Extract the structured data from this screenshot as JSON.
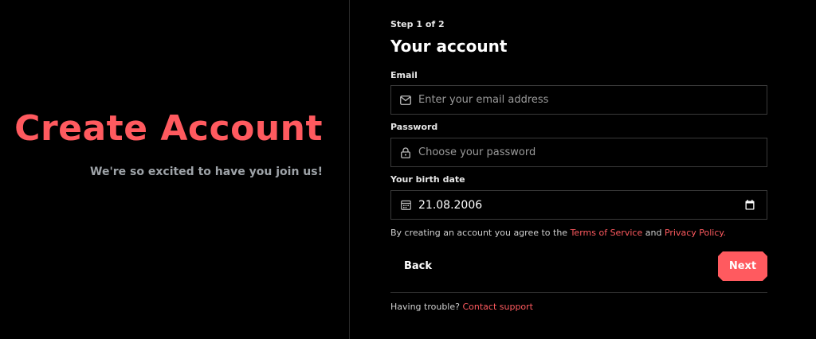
{
  "hero": {
    "title": "Create Account",
    "subtitle": "We're so excited to have you join us!"
  },
  "form": {
    "step": "Step 1 of 2",
    "title": "Your account",
    "email": {
      "label": "Email",
      "placeholder": "Enter your email address",
      "value": "",
      "icon": "mail-icon"
    },
    "password": {
      "label": "Password",
      "placeholder": "Choose your password",
      "value": "",
      "icon": "lock-icon"
    },
    "birth_date": {
      "label": "Your birth date",
      "value": "21.08.2006",
      "icon": "calendar-icon",
      "picker_icon": "calendar-picker-icon"
    },
    "terms": {
      "prefix": "By creating an account you agree to the ",
      "tos_link": "Terms of Service",
      "middle": " and ",
      "privacy_link": "Privacy Policy",
      "suffix": "."
    },
    "back_label": "Back",
    "next_label": "Next",
    "trouble": {
      "prefix": "Having trouble? ",
      "link": "Contact support"
    }
  },
  "colors": {
    "accent": "#ff5a5f",
    "background": "#000000",
    "muted_text": "#9ea3a8",
    "border": "#3a3a3a"
  }
}
